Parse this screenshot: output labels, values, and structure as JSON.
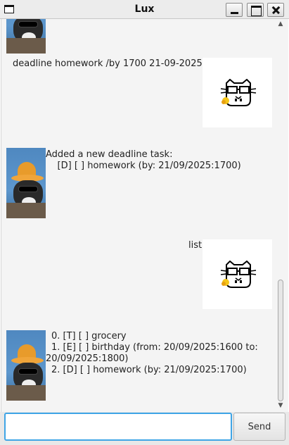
{
  "window": {
    "title": "Lux"
  },
  "messages": {
    "user1": "deadline homework /by 1700 21-09-2025",
    "bot1_line1": "Added a new deadline task:",
    "bot1_line2": "    [D] [ ] homework (by: 21/09/2025:1700)",
    "user2": "list",
    "bot2_line1": "0. [T] [ ] grocery",
    "bot2_line2": "1. [E] [ ] birthday (from: 20/09/2025:1600 to:",
    "bot2_line3": "20/09/2025:1800)",
    "bot2_line4": "2. [D] [ ] homework (by: 21/09/2025:1700)"
  },
  "input": {
    "value": "",
    "placeholder": ""
  },
  "send": {
    "label": "Send"
  },
  "icons": {
    "window": "window-icon",
    "minimize": "minimize-icon",
    "maximize": "maximize-icon",
    "close": "close-icon",
    "bot_avatar": "duke-cat-avatar",
    "user_avatar": "cat-with-glasses-avatar"
  }
}
